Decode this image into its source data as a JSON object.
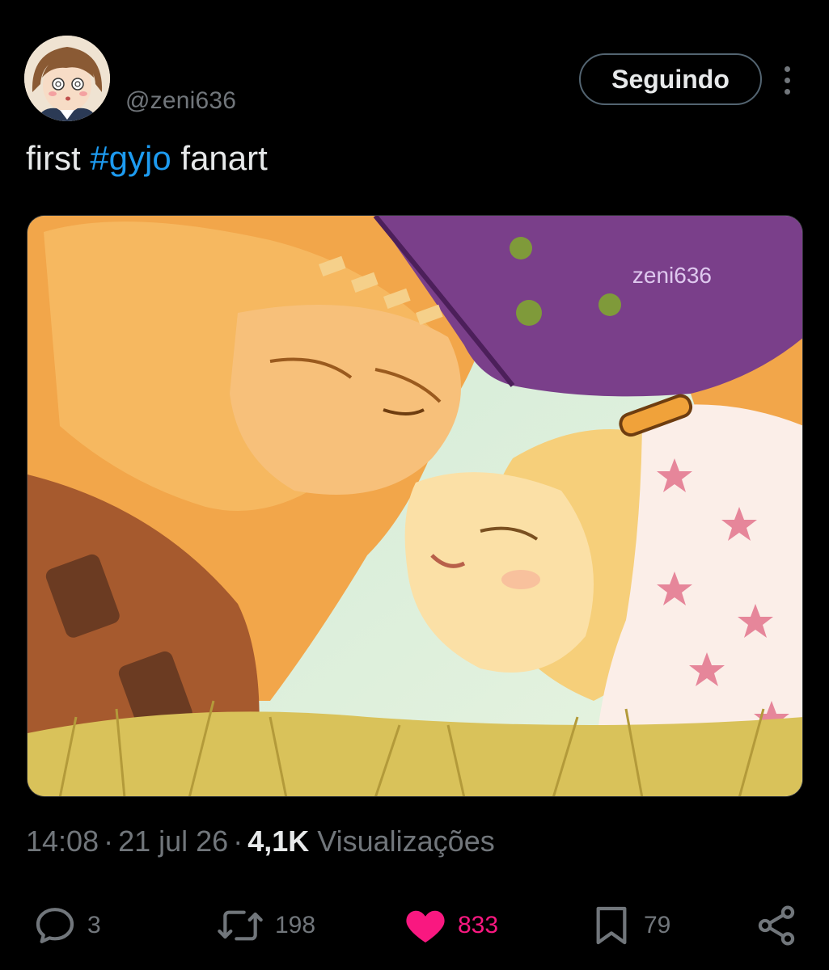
{
  "author": {
    "handle": "@zeni636",
    "avatar_icon": "avatar-icon"
  },
  "header": {
    "follow_label": "Seguindo",
    "more_icon": "more-vertical-icon"
  },
  "tweet": {
    "text_before": "first ",
    "hashtag": "#gyjo",
    "text_after": " fanart"
  },
  "media": {
    "watermark": "zeni636"
  },
  "meta": {
    "time": "14:08",
    "separator": "·",
    "date": "21 jul 26",
    "views_count": "4,1K",
    "views_label": "Visualizações"
  },
  "actions": {
    "reply": {
      "icon": "reply-icon",
      "count": "3"
    },
    "retweet": {
      "icon": "retweet-icon",
      "count": "198"
    },
    "like": {
      "icon": "heart-icon",
      "count": "833",
      "active": true
    },
    "bookmark": {
      "icon": "bookmark-icon",
      "count": "79"
    },
    "share": {
      "icon": "share-icon"
    }
  },
  "colors": {
    "background": "#000000",
    "text": "#e7e9ea",
    "muted": "#71767b",
    "link": "#1d9bf0",
    "like": "#f91880",
    "border": "#536471"
  }
}
